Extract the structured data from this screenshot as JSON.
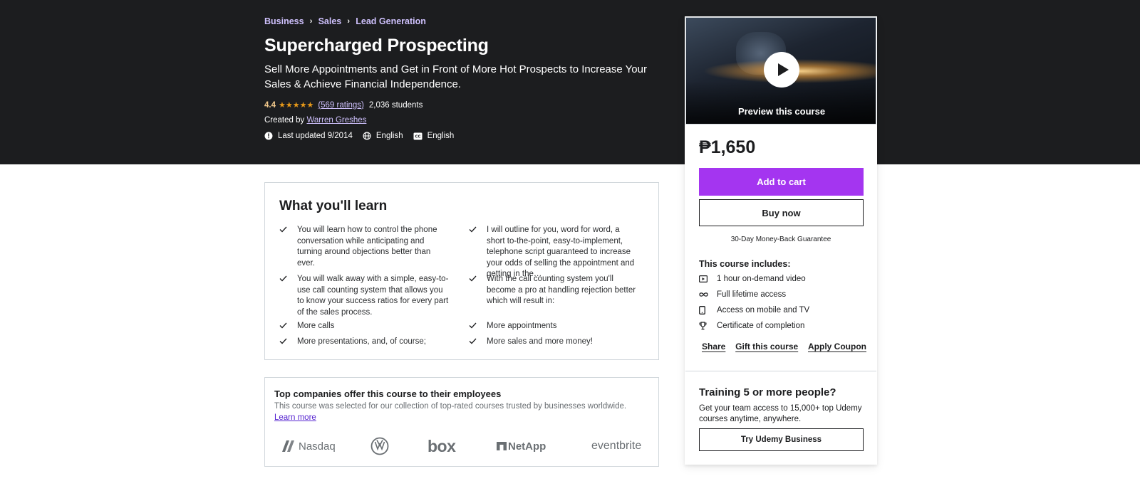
{
  "breadcrumb": [
    "Business",
    "Sales",
    "Lead Generation"
  ],
  "course": {
    "title": "Supercharged Prospecting",
    "subtitle": "Sell More Appointments and Get in Front of More Hot Prospects to Increase Your Sales & Achieve Financial Independence.",
    "rating": "4.4",
    "ratings_count": "(569 ratings)",
    "students": "2,036 students",
    "created_by_label": "Created by",
    "instructor": "Warren Greshes",
    "last_updated": "Last updated 9/2014",
    "language": "English",
    "captions": "English"
  },
  "colors": {
    "hero_bg": "#1c1d1f",
    "accent_purple": "#a435f0",
    "link_purple": "#cec0fc",
    "rating_gold": "#f3ca8c",
    "star_orange": "#e59819"
  },
  "learn": {
    "title": "What you'll learn",
    "items": [
      "You will learn how to control the phone conversation while anticipating and turning around objections better than ever.",
      "I will outline for you, word for word, a short to-the-point, easy-to-implement, telephone script guaranteed to increase your odds of selling the appointment and getting in the…",
      "You will walk away with a simple, easy-to-use call counting system that allows you to know your success ratios for every part of the sales process.",
      "With the call counting system you'll become a pro at handling rejection better which will result in:",
      "More calls",
      "More appointments",
      "More presentations, and, of course;",
      "More sales and more money!"
    ]
  },
  "companies": {
    "title": "Top companies offer this course to their employees",
    "desc": "This course was selected for our collection of top-rated courses trusted by businesses worldwide.",
    "learn_more": "Learn more",
    "logos": [
      "Nasdaq",
      "VW",
      "box",
      "NetApp",
      "eventbrite"
    ]
  },
  "sidebar": {
    "preview_label": "Preview this course",
    "price": "₱1,650",
    "add_to_cart": "Add to cart",
    "buy_now": "Buy now",
    "guarantee": "30-Day Money-Back Guarantee",
    "includes_title": "This course includes:",
    "includes": [
      {
        "icon": "video-icon",
        "label": "1 hour on-demand video"
      },
      {
        "icon": "infinity-icon",
        "label": "Full lifetime access"
      },
      {
        "icon": "mobile-icon",
        "label": "Access on mobile and TV"
      },
      {
        "icon": "trophy-icon",
        "label": "Certificate of completion"
      }
    ],
    "share": "Share",
    "gift": "Gift this course",
    "coupon": "Apply Coupon",
    "team_title": "Training 5 or more people?",
    "team_desc": "Get your team access to 15,000+ top Udemy courses anytime, anywhere.",
    "team_button": "Try Udemy Business"
  }
}
